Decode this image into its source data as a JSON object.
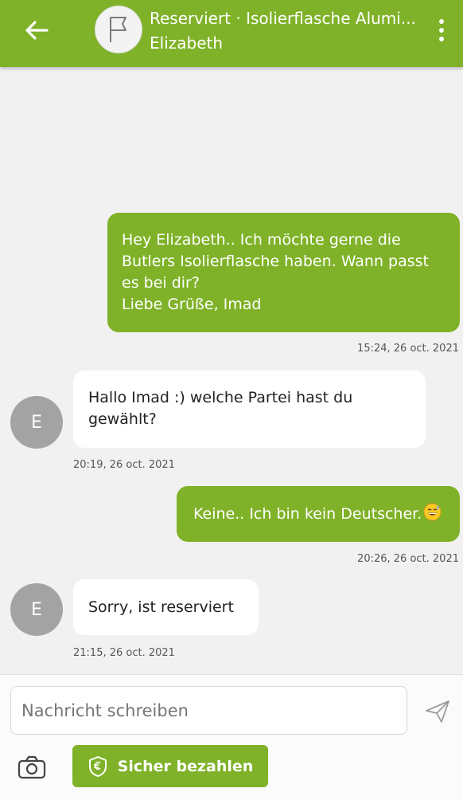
{
  "header": {
    "title": "Reserviert · Isolierflasche Alumi...",
    "subtitle": "Elizabeth",
    "icons": {
      "back": "arrow-left-icon",
      "item": "flag-placeholder-icon",
      "menu": "more-vert-icon"
    }
  },
  "messages": [
    {
      "direction": "outgoing",
      "lines": [
        "Hey Elizabeth.. Ich möchte gerne die",
        "Butlers Isolierflasche haben. Wann passt",
        "es bei dir?",
        "Liebe Grüße, Imad"
      ],
      "time": "15:24, 26 oct. 2021"
    },
    {
      "direction": "incoming",
      "avatar": "E",
      "lines": [
        "Hallo Imad :) welche Partei hast du",
        "gewählt?"
      ],
      "time": "20:19, 26 oct. 2021"
    },
    {
      "direction": "outgoing",
      "text": "Keine.. Ich bin kein Deutscher.",
      "emoji": "grinning-sweat-emoji",
      "time": "20:26, 26 oct. 2021"
    },
    {
      "direction": "incoming",
      "avatar": "E",
      "text": "Sorry, ist reserviert",
      "time": "21:15, 26 oct. 2021"
    }
  ],
  "composer": {
    "placeholder": "Nachricht schreiben",
    "pay_label": "Sicher bezahlen",
    "icons": {
      "send": "send-icon",
      "camera": "camera-icon",
      "pay": "euro-shield-icon"
    }
  },
  "colors": {
    "accent": "#7fb228",
    "background": "#f1f1f1",
    "avatar": "#a3a3a3"
  }
}
